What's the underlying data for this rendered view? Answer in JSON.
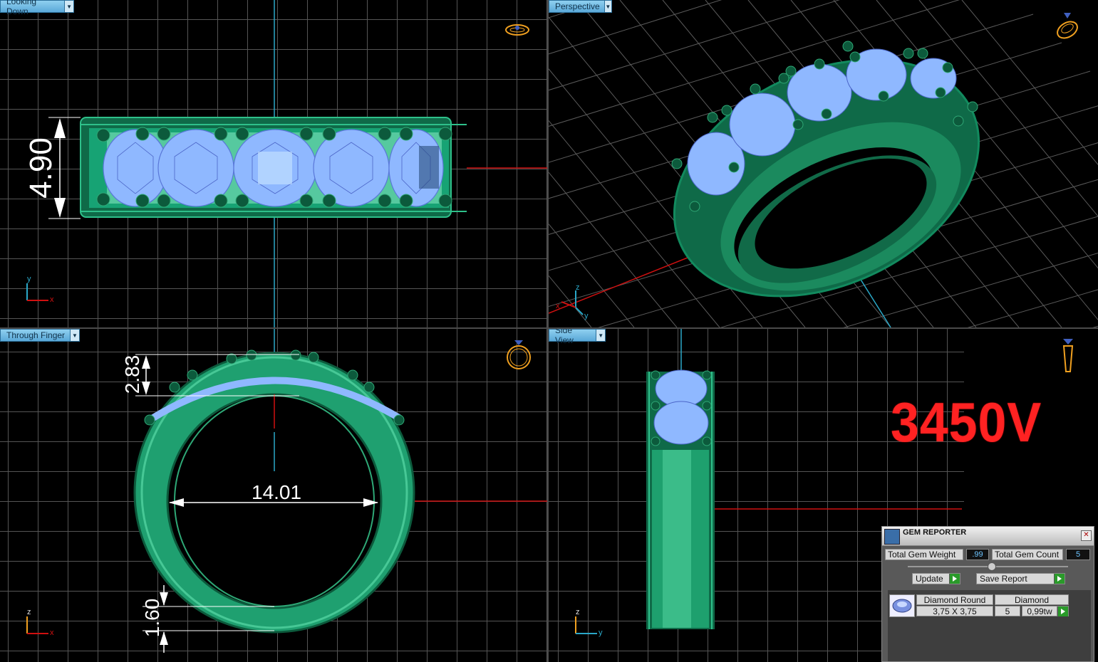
{
  "viewports": {
    "top_left": {
      "title": "Looking Down",
      "dimension": "4.90",
      "axis_v": "y",
      "axis_h": "x"
    },
    "top_right": {
      "title": "Perspective",
      "axis_v": "z",
      "axis_h1": "x",
      "axis_h2": "y"
    },
    "bottom_left": {
      "title": "Through Finger",
      "dim_top": "2.83",
      "dim_inner": "14.01",
      "dim_bottom": "1.60",
      "axis_v": "z",
      "axis_h": "x"
    },
    "bottom_right": {
      "title": "Side View",
      "model_code": "3450V",
      "axis_v": "z",
      "axis_h": "y"
    }
  },
  "gem_reporter": {
    "title": "GEM REPORTER",
    "close": "✕",
    "total_gem_weight_label": "Total Gem Weight",
    "total_gem_weight": ".99",
    "total_gem_count_label": "Total Gem Count",
    "total_gem_count": "5",
    "update_label": "Update",
    "save_report_label": "Save Report",
    "gem": {
      "shape": "Diamond Round",
      "size": "3,75 X 3,75",
      "material": "Diamond",
      "count": "5",
      "weight": "0,99tw"
    }
  },
  "colors": {
    "ring": "#1f9a66",
    "gem": "#8fb8ff",
    "tab": "#6ab8e4",
    "axis_red": "#d01010",
    "axis_cyan": "#2aa8c8",
    "label_red": "#ff2222"
  }
}
